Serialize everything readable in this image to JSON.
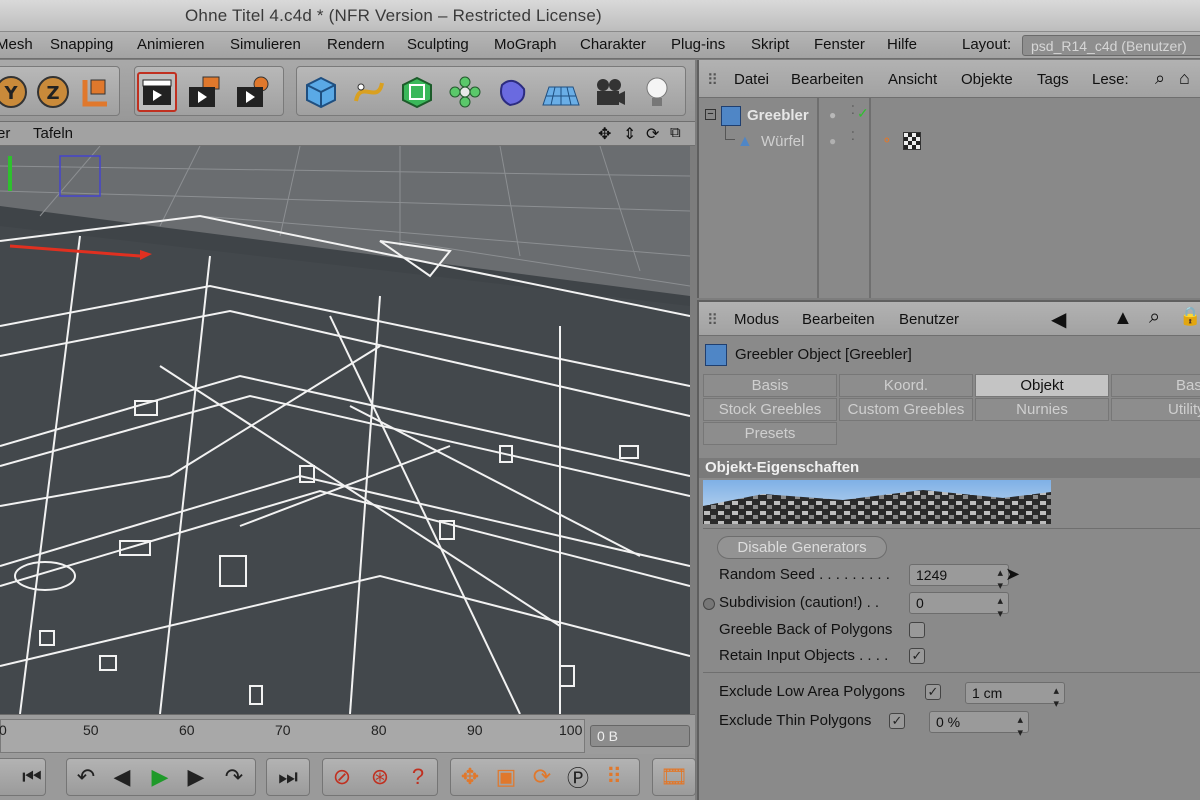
{
  "window": {
    "title": "Ohne Titel 4.c4d * (NFR Version – Restricted License)"
  },
  "menubar": {
    "items": [
      "Mesh",
      "Snapping",
      "Animieren",
      "Simulieren",
      "Rendern",
      "Sculpting",
      "MoGraph",
      "Charakter",
      "Plug-ins",
      "Skript",
      "Fenster",
      "Hilfe"
    ],
    "layout_label": "Layout:",
    "layout_value": "psd_R14_c4d (Benutzer)"
  },
  "toolbar": {
    "icons": [
      "rotate-y-icon",
      "rotate-z-icon",
      "coordinate-system-icon",
      "render-view-icon",
      "render-picture-viewer-icon",
      "render-settings-icon",
      "cube-icon",
      "spline-pen-icon",
      "subdivision-icon",
      "cloner-icon",
      "deformer-icon",
      "floor-icon",
      "camera-icon",
      "light-icon"
    ]
  },
  "viewport": {
    "menu": [
      "er",
      "Tafeln"
    ],
    "icons": [
      "move-view-icon",
      "zoom-view-icon",
      "rotate-view-icon",
      "maximize-view-icon"
    ]
  },
  "timeline": {
    "ticks": [
      "0",
      "50",
      "60",
      "70",
      "80",
      "90",
      "100"
    ],
    "frame_value": "0 B"
  },
  "object_manager": {
    "menu": [
      "Datei",
      "Bearbeiten",
      "Ansicht",
      "Objekte",
      "Tags",
      "Lese:"
    ],
    "objects": [
      {
        "name": "Greebler",
        "type": "greebler"
      },
      {
        "name": "Würfel",
        "type": "cube"
      }
    ]
  },
  "attribute_manager": {
    "menu": [
      "Modus",
      "Bearbeiten",
      "Benutzer"
    ],
    "object_title": "Greebler Object [Greebler]",
    "tabs": [
      {
        "label": "Basis",
        "active": false
      },
      {
        "label": "Koord.",
        "active": false
      },
      {
        "label": "Objekt",
        "active": true
      },
      {
        "label": "Base",
        "active": false
      },
      {
        "label": "Stock Greebles",
        "active": false
      },
      {
        "label": "Custom Greebles",
        "active": false
      },
      {
        "label": "Nurnies",
        "active": false
      },
      {
        "label": "Utility",
        "active": false
      },
      {
        "label": "Presets",
        "active": false
      }
    ],
    "section_title": "Objekt-Eigenschaften",
    "disable_generators_label": "Disable Generators",
    "properties": {
      "random_seed": {
        "label": "Random Seed . . . . . . . . .",
        "value": "1249"
      },
      "subdivision": {
        "label": "Subdivision (caution!) . .",
        "value": "0"
      },
      "greeble_back": {
        "label": "Greeble Back of Polygons",
        "checked": false
      },
      "retain_input": {
        "label": "Retain Input Objects . . . .",
        "checked": true
      },
      "exclude_low_area": {
        "label": "Exclude Low Area Polygons",
        "checked": true,
        "value": "1 cm"
      },
      "exclude_thin": {
        "label": "Exclude Thin Polygons",
        "checked": true,
        "value": "0 %"
      }
    }
  },
  "colors": {
    "ui_gray": "#8a8a8a",
    "viewport_bg": "#3f4448",
    "active_tab": "#c4c4c4",
    "accent_green": "#2ec02e",
    "accent_orange": "#e8742a"
  }
}
